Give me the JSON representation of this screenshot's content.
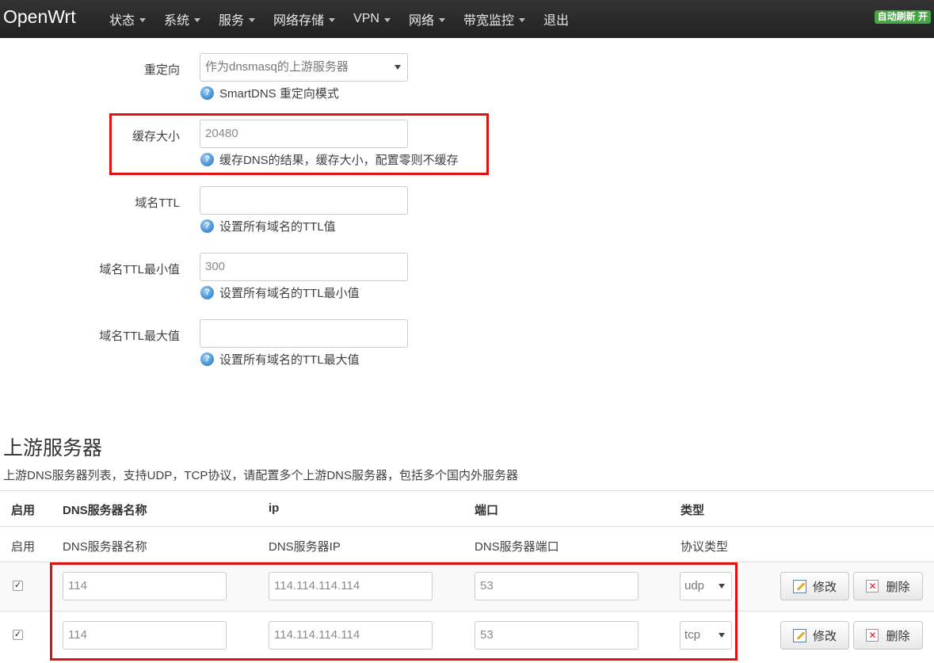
{
  "navbar": {
    "brand": "OpenWrt",
    "menu": [
      {
        "label": "状态",
        "has_caret": true
      },
      {
        "label": "系统",
        "has_caret": true
      },
      {
        "label": "服务",
        "has_caret": true
      },
      {
        "label": "网络存储",
        "has_caret": true
      },
      {
        "label": "VPN",
        "has_caret": true
      },
      {
        "label": "网络",
        "has_caret": true
      },
      {
        "label": "带宽监控",
        "has_caret": true
      },
      {
        "label": "退出",
        "has_caret": false
      }
    ],
    "auto_refresh": "自动刷新 开"
  },
  "form": {
    "redirect": {
      "label": "重定向",
      "value": "作为dnsmasq的上游服务器",
      "help": "SmartDNS 重定向模式"
    },
    "cache_size": {
      "label": "缓存大小",
      "placeholder": "20480",
      "help": "缓存DNS的结果，缓存大小，配置零则不缓存"
    },
    "ttl": {
      "label": "域名TTL",
      "placeholder": "",
      "help": "设置所有域名的TTL值"
    },
    "ttl_min": {
      "label": "域名TTL最小值",
      "placeholder": "300",
      "help": "设置所有域名的TTL最小值"
    },
    "ttl_max": {
      "label": "域名TTL最大值",
      "placeholder": "",
      "help": "设置所有域名的TTL最大值"
    }
  },
  "upstream": {
    "title": "上游服务器",
    "description": "上游DNS服务器列表，支持UDP，TCP协议，请配置多个上游DNS服务器，包括多个国内外服务器",
    "headers": [
      "启用",
      "DNS服务器名称",
      "ip",
      "端口",
      "类型"
    ],
    "descriptions": [
      "启用",
      "DNS服务器名称",
      "DNS服务器IP",
      "DNS服务器端口",
      "协议类型"
    ],
    "rows": [
      {
        "enabled": true,
        "name": "114",
        "ip": "114.114.114.114",
        "port": "53",
        "type": "udp"
      },
      {
        "enabled": true,
        "name": "114",
        "ip": "114.114.114.114",
        "port": "53",
        "type": "tcp"
      }
    ],
    "edit_label": "修改",
    "delete_label": "删除"
  }
}
